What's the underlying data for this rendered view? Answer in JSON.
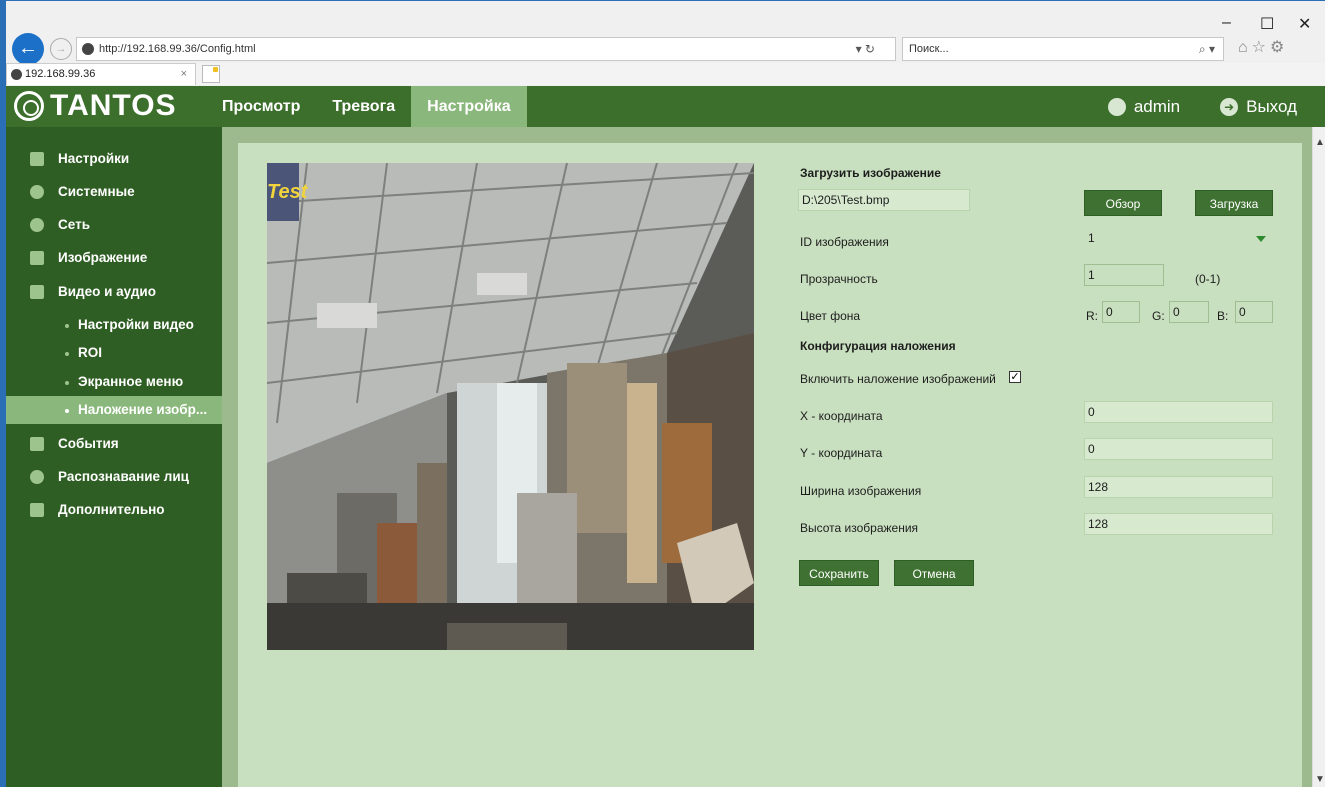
{
  "browser": {
    "url": "http://192.168.99.36/Config.html",
    "search_placeholder": "Поиск...",
    "tab_title": "192.168.99.36",
    "minimize": "–",
    "maximize": "☐",
    "close": "✕"
  },
  "header": {
    "logo": "TANTOS",
    "nav": [
      "Просмотр",
      "Тревога",
      "Настройка"
    ],
    "active_nav": "Настройка",
    "user": "admin",
    "logout": "Выход"
  },
  "sidebar": {
    "items": [
      {
        "label": "Настройки",
        "icon": "monitor-icon"
      },
      {
        "label": "Системные",
        "icon": "info-icon"
      },
      {
        "label": "Сеть",
        "icon": "globe-icon"
      },
      {
        "label": "Изображение",
        "icon": "image-icon"
      },
      {
        "label": "Видео и аудио",
        "icon": "video-icon"
      }
    ],
    "sub_items": [
      {
        "label": "Настройки видео"
      },
      {
        "label": "ROI"
      },
      {
        "label": "Экранное меню"
      },
      {
        "label": "Наложение изобр..."
      }
    ],
    "selected_sub": "Наложение изобр...",
    "items_after": [
      {
        "label": "События",
        "icon": "bell-icon"
      },
      {
        "label": "Распознавание лиц",
        "icon": "face-icon"
      },
      {
        "label": "Дополнительно",
        "icon": "tools-icon"
      }
    ]
  },
  "preview": {
    "overlay_text": "Test"
  },
  "form": {
    "upload_title": "Загрузить изображение",
    "file_path": "D:\\205\\Test.bmp",
    "browse_button": "Обзор",
    "upload_button": "Загрузка",
    "image_id_label": "ID изображения",
    "image_id_value": "1",
    "transparency_label": "Прозрачность",
    "transparency_value": "1",
    "transparency_range": "(0-1)",
    "bg_color_label": "Цвет фона",
    "r_label": "R:",
    "r_value": "0",
    "g_label": "G:",
    "g_value": "0",
    "b_label": "B:",
    "b_value": "0",
    "overlay_config_title": "Конфигурация наложения",
    "enable_overlay_label": "Включить наложение изображений",
    "enable_overlay_checked": true,
    "x_label": "X - координата",
    "x_value": "0",
    "y_label": "Y - координата",
    "y_value": "0",
    "width_label": "Ширина изображения",
    "width_value": "128",
    "height_label": "Высота изображения",
    "height_value": "128",
    "save_button": "Сохранить",
    "cancel_button": "Отмена"
  },
  "colors": {
    "header_bg": "#3c6e2c",
    "sidebar_bg": "#2f5e24",
    "active_bg": "#8ab77b",
    "panel_bg": "#c9e0c0",
    "button_bg": "#3f7232"
  }
}
